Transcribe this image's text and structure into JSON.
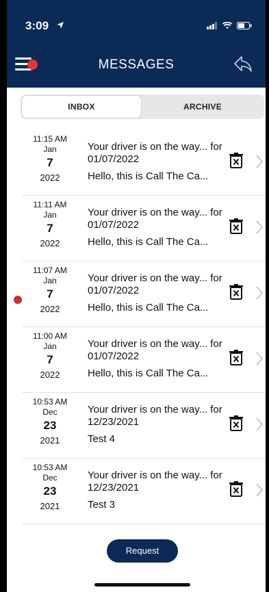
{
  "status_bar": {
    "time": "3:09"
  },
  "header": {
    "title": "MESSAGES",
    "menu_icon": "hamburger-menu-icon",
    "back_icon": "share-back-icon"
  },
  "tabs": [
    {
      "label": "INBOX",
      "active": true
    },
    {
      "label": "ARCHIVE",
      "active": false
    }
  ],
  "messages": [
    {
      "time": "11:15 AM",
      "month": "Jan",
      "day": "7",
      "year": "2022",
      "title": "Your driver is on the way... for 01/07/2022",
      "preview": "Hello, this is Call The Ca...",
      "unread": false
    },
    {
      "time": "11:11 AM",
      "month": "Jan",
      "day": "7",
      "year": "2022",
      "title": "Your driver is on the way... for 01/07/2022",
      "preview": "Hello, this is Call The Ca...",
      "unread": false
    },
    {
      "time": "11:07 AM",
      "month": "Jan",
      "day": "7",
      "year": "2022",
      "title": "Your driver is on the way... for 01/07/2022",
      "preview": "Hello, this is Call The Ca...",
      "unread": true
    },
    {
      "time": "11:00 AM",
      "month": "Jan",
      "day": "7",
      "year": "2022",
      "title": "Your driver is on the way... for 01/07/2022",
      "preview": "Hello, this is Call The Ca...",
      "unread": false
    },
    {
      "time": "10:53 AM",
      "month": "Dec",
      "day": "23",
      "year": "2021",
      "title": "Your driver is on the way... for 12/23/2021",
      "preview": "Test 4",
      "unread": false
    },
    {
      "time": "10:53 AM",
      "month": "Dec",
      "day": "23",
      "year": "2021",
      "title": "Your driver is on the way... for 12/23/2021",
      "preview": "Test 3",
      "unread": false
    }
  ],
  "footer": {
    "request_label": "Request"
  },
  "colors": {
    "header": "#0b2a55",
    "unread_dot": "#c8312b",
    "menu_badge": "#e33a2f"
  }
}
